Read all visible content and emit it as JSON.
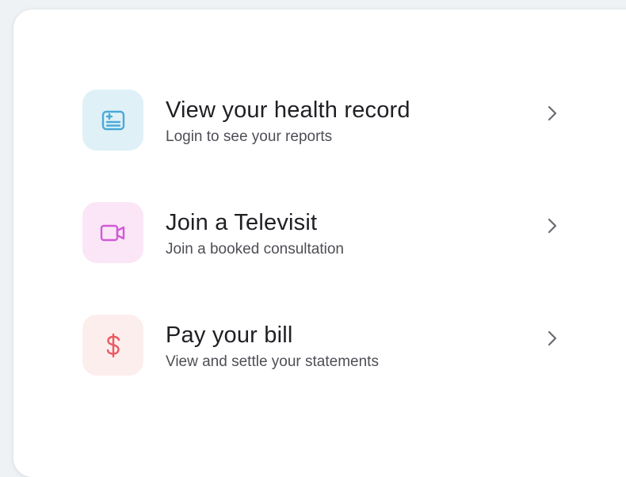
{
  "colors": {
    "health_tile_bg": "#dff1f7",
    "health_icon": "#4aa9d8",
    "tele_tile_bg": "#fbe6f7",
    "tele_icon": "#d05ad6",
    "bill_tile_bg": "#fdeeee",
    "bill_icon": "#ea5a5f",
    "chevron": "#6a6a72"
  },
  "menu": {
    "items": [
      {
        "title": "View your health record",
        "subtitle": "Login to see your reports",
        "icon": "health-record-icon"
      },
      {
        "title": "Join a Televisit",
        "subtitle": "Join a booked consultation",
        "icon": "video-camera-icon"
      },
      {
        "title": "Pay your bill",
        "subtitle": "View and settle your statements",
        "icon": "dollar-icon"
      }
    ]
  }
}
